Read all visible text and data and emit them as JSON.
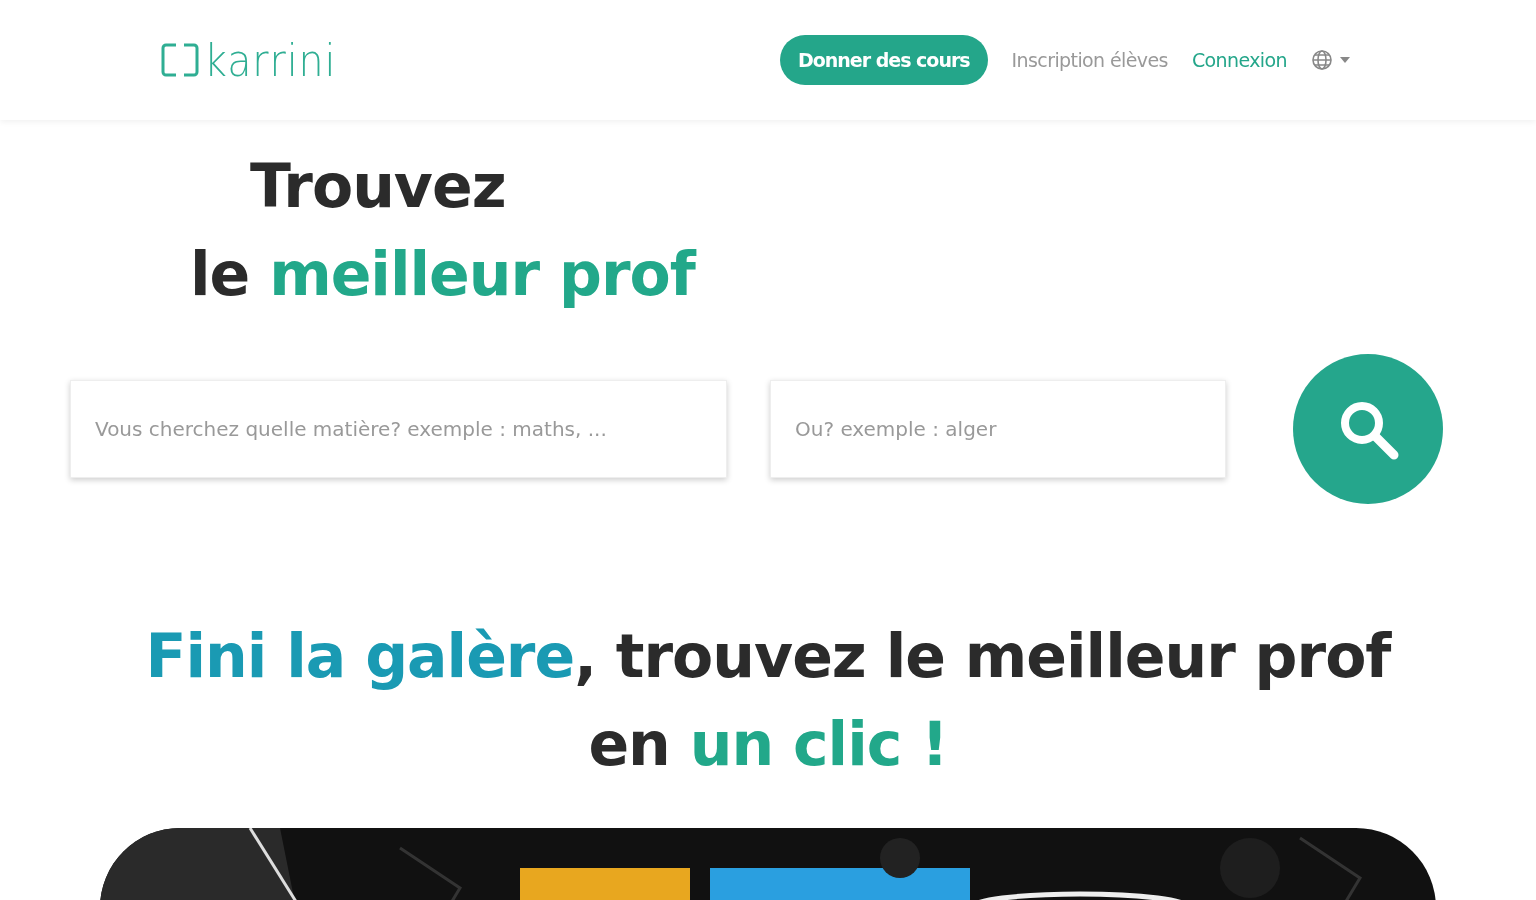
{
  "header": {
    "logo": "karrini",
    "nav": [
      {
        "kind": "button",
        "label": "Donner des cours"
      },
      {
        "kind": "muted",
        "label": "Inscription élèves"
      },
      {
        "kind": "link",
        "label": "Connexion"
      },
      {
        "kind": "language"
      }
    ]
  },
  "hero": {
    "title_lines": [
      [
        {
          "text": "Trouvez",
          "color": "#2b2b2b"
        }
      ],
      [
        {
          "text": "le ",
          "color": "#2b2b2b"
        },
        {
          "text": "meilleur prof",
          "color": "#22a88a"
        }
      ]
    ],
    "search": {
      "subject_placeholder": "Vous cherchez quelle matière? exemple : maths, ...",
      "place_placeholder": "Ou? exemple : alger"
    }
  },
  "tagline": [
    [
      {
        "text": "Fini la galère",
        "color": "#1a9ab3"
      },
      {
        "text": ", trouvez le meilleur prof",
        "color": "#2b2b2b"
      }
    ],
    [
      {
        "text": "en ",
        "color": "#2b2b2b"
      },
      {
        "text": "un clic !",
        "color": "#22a88a"
      }
    ]
  ]
}
